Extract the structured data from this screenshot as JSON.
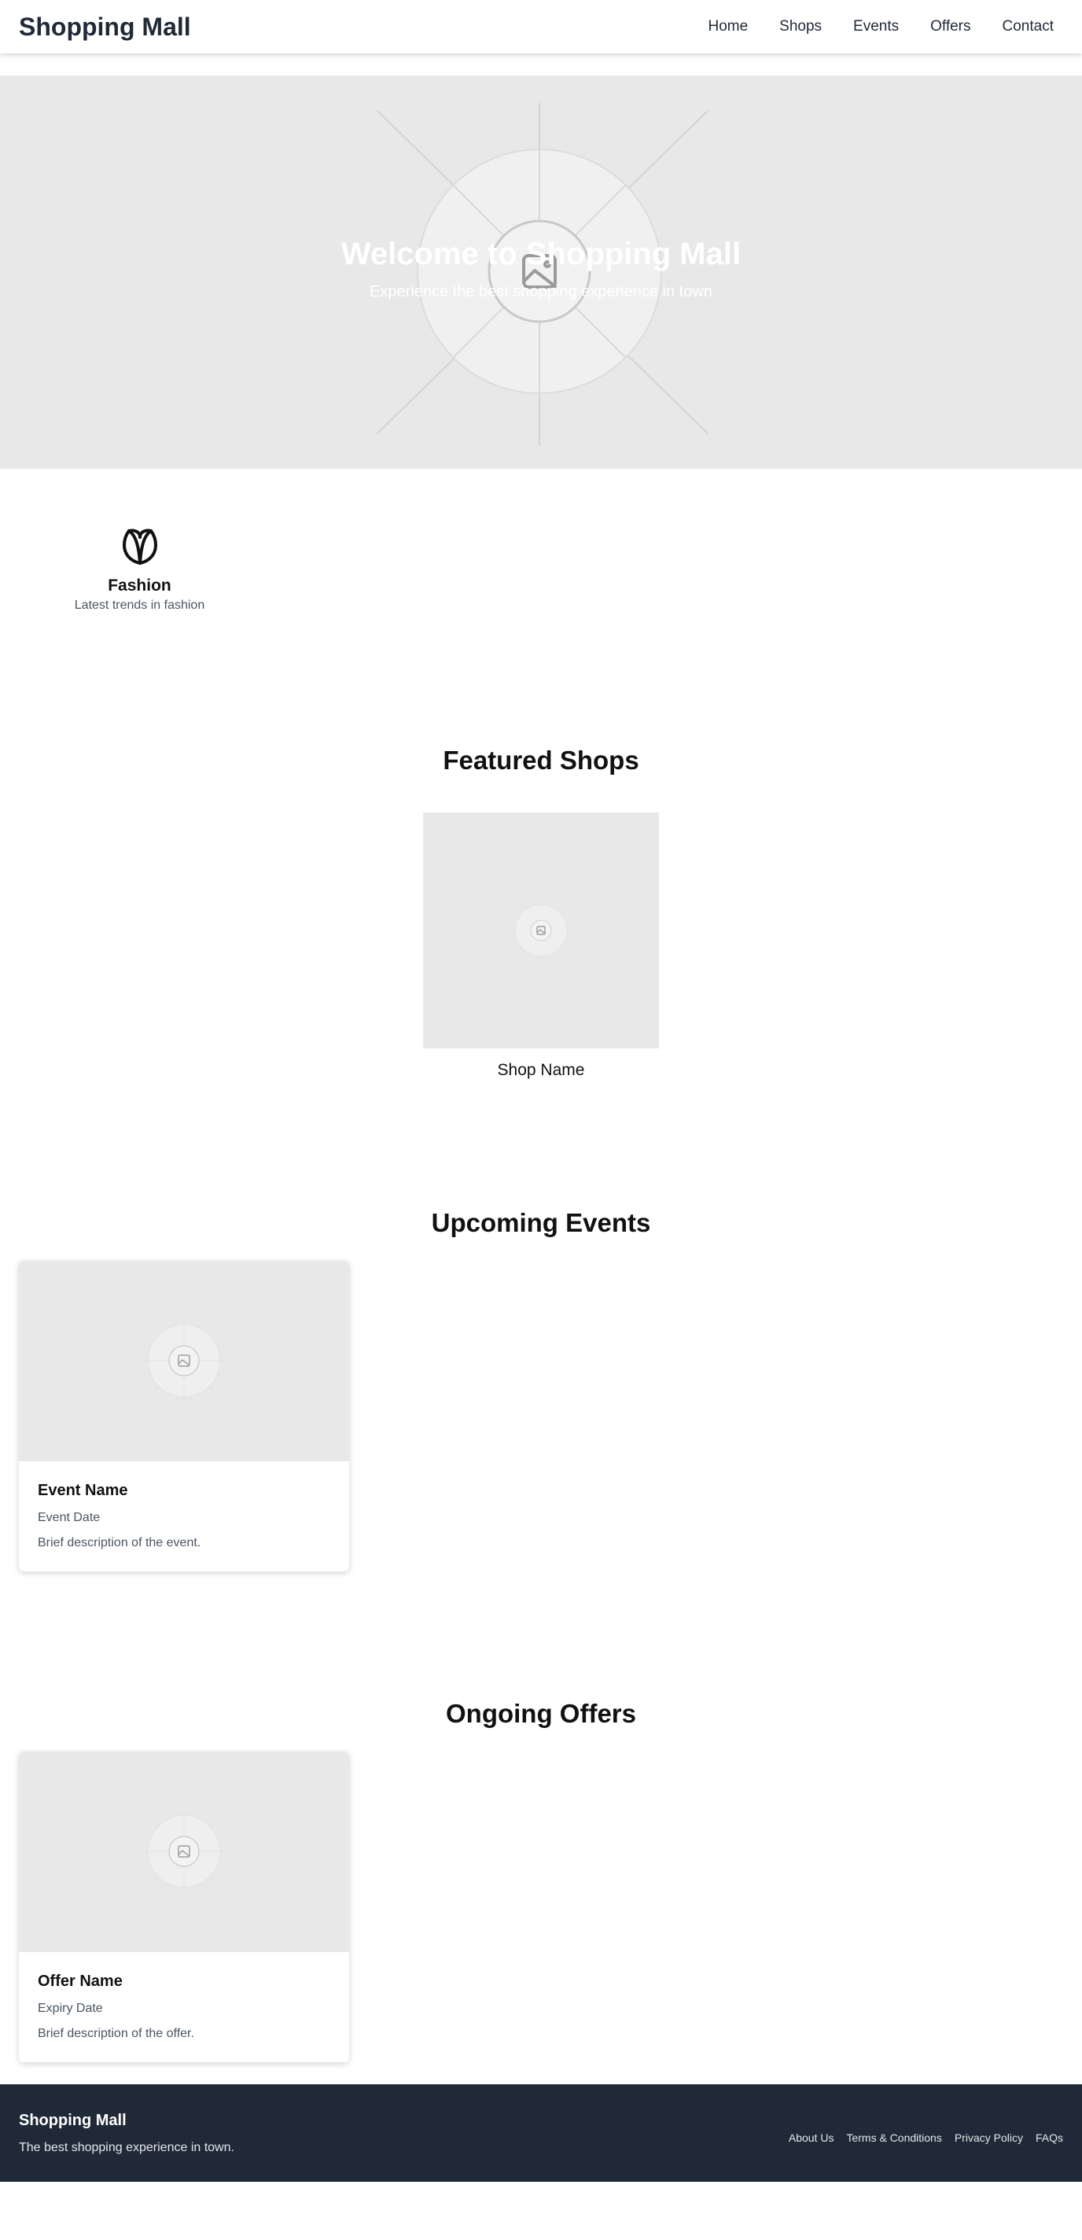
{
  "header": {
    "brand": "Shopping Mall",
    "nav": [
      "Home",
      "Shops",
      "Events",
      "Offers",
      "Contact"
    ]
  },
  "hero": {
    "title": "Welcome to Shopping Mall",
    "subtitle": "Experience the best shopping experience in town",
    "image_icon": "image-placeholder-icon"
  },
  "categories": [
    {
      "icon": "leaf-icon",
      "title": "Fashion",
      "description": "Latest trends in fashion"
    }
  ],
  "featured_shops": {
    "title": "Featured Shops",
    "shops": [
      {
        "name": "Shop Name",
        "image_icon": "image-placeholder-icon"
      }
    ]
  },
  "events": {
    "title": "Upcoming Events",
    "items": [
      {
        "name": "Event Name",
        "date": "Event Date",
        "description": "Brief description of the event.",
        "image_icon": "image-placeholder-icon"
      }
    ]
  },
  "offers": {
    "title": "Ongoing Offers",
    "items": [
      {
        "name": "Offer Name",
        "date": "Expiry Date",
        "description": "Brief description of the offer.",
        "image_icon": "image-placeholder-icon"
      }
    ]
  },
  "footer": {
    "title": "Shopping Mall",
    "tagline": "The best shopping experience in town.",
    "links": [
      "About Us",
      "Terms & Conditions",
      "Privacy Policy",
      "FAQs"
    ]
  },
  "colors": {
    "header_text": "#1f2937",
    "footer_bg": "#1f2937",
    "placeholder_bg": "#e8e8e8",
    "muted_text": "#4b5563"
  }
}
